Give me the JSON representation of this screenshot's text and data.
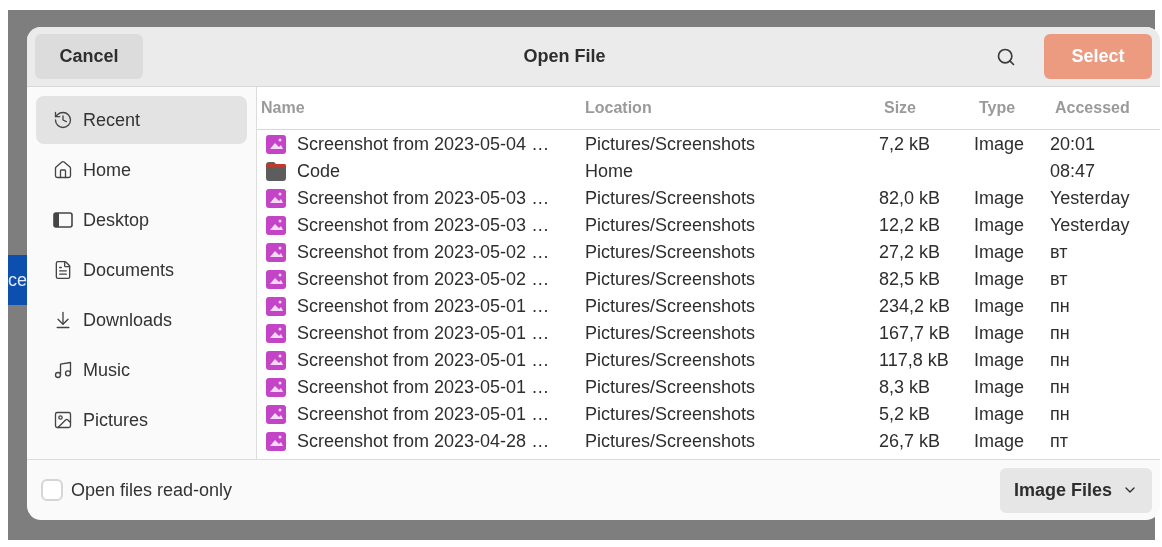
{
  "background": {
    "button_fragment": "ce"
  },
  "dialog": {
    "title": "Open File",
    "cancel": "Cancel",
    "select": "Select"
  },
  "sidebar": {
    "items": [
      {
        "label": "Recent",
        "selected": true
      },
      {
        "label": "Home",
        "selected": false
      },
      {
        "label": "Desktop",
        "selected": false
      },
      {
        "label": "Documents",
        "selected": false
      },
      {
        "label": "Downloads",
        "selected": false
      },
      {
        "label": "Music",
        "selected": false
      },
      {
        "label": "Pictures",
        "selected": false
      }
    ]
  },
  "table": {
    "columns": [
      "Name",
      "Location",
      "Size",
      "Type",
      "Accessed"
    ],
    "rows": [
      {
        "kind": "image",
        "name": "Screenshot from 2023-05-04 …",
        "location": "Pictures/Screenshots",
        "size": "7,2 kB",
        "type": "Image",
        "accessed": "20:01"
      },
      {
        "kind": "folder",
        "name": "Code",
        "location": "Home",
        "accessed": "08:47"
      },
      {
        "kind": "image",
        "name": "Screenshot from 2023-05-03 …",
        "location": "Pictures/Screenshots",
        "size": "82,0 kB",
        "type": "Image",
        "accessed": "Yesterday"
      },
      {
        "kind": "image",
        "name": "Screenshot from 2023-05-03 …",
        "location": "Pictures/Screenshots",
        "size": "12,2 kB",
        "type": "Image",
        "accessed": "Yesterday"
      },
      {
        "kind": "image",
        "name": "Screenshot from 2023-05-02 …",
        "location": "Pictures/Screenshots",
        "size": "27,2 kB",
        "type": "Image",
        "accessed": "вт"
      },
      {
        "kind": "image",
        "name": "Screenshot from 2023-05-02 …",
        "location": "Pictures/Screenshots",
        "size": "82,5 kB",
        "type": "Image",
        "accessed": "вт"
      },
      {
        "kind": "image",
        "name": "Screenshot from 2023-05-01 …",
        "location": "Pictures/Screenshots",
        "size": "234,2 kB",
        "type": "Image",
        "accessed": "пн"
      },
      {
        "kind": "image",
        "name": "Screenshot from 2023-05-01 …",
        "location": "Pictures/Screenshots",
        "size": "167,7 kB",
        "type": "Image",
        "accessed": "пн"
      },
      {
        "kind": "image",
        "name": "Screenshot from 2023-05-01 …",
        "location": "Pictures/Screenshots",
        "size": "117,8 kB",
        "type": "Image",
        "accessed": "пн"
      },
      {
        "kind": "image",
        "name": "Screenshot from 2023-05-01 …",
        "location": "Pictures/Screenshots",
        "size": "8,3 kB",
        "type": "Image",
        "accessed": "пн"
      },
      {
        "kind": "image",
        "name": "Screenshot from 2023-05-01 …",
        "location": "Pictures/Screenshots",
        "size": "5,2 kB",
        "type": "Image",
        "accessed": "пн"
      },
      {
        "kind": "image",
        "name": "Screenshot from 2023-04-28 …",
        "location": "Pictures/Screenshots",
        "size": "26,7 kB",
        "type": "Image",
        "accessed": "пт"
      }
    ]
  },
  "footer": {
    "read_only": {
      "label": "Open files read-only",
      "checked": false
    },
    "filter": "Image Files"
  }
}
